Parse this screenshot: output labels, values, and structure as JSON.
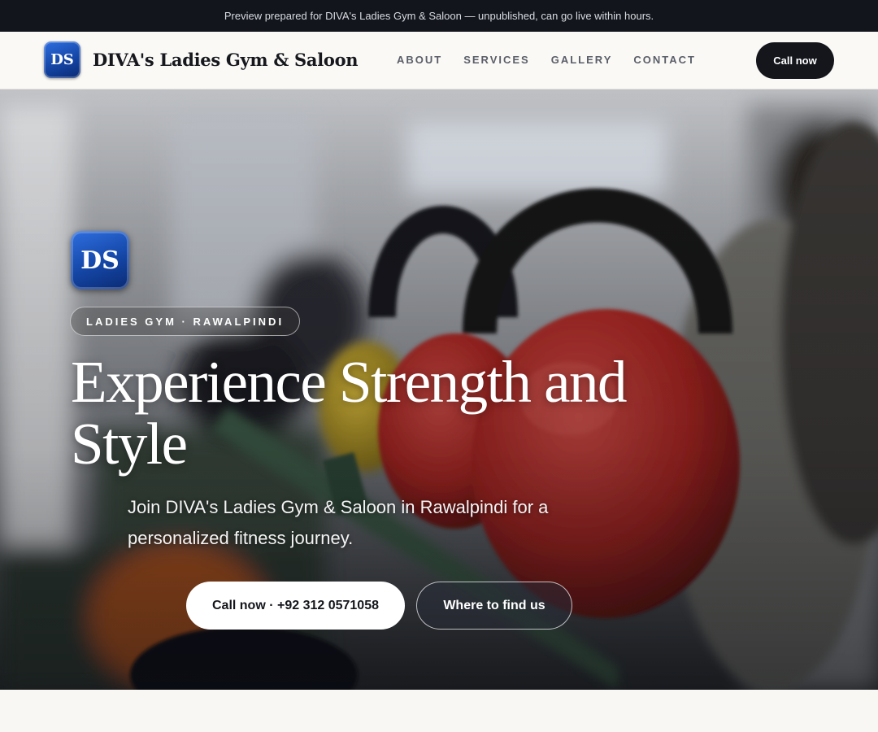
{
  "preview_banner": {
    "text": "Preview prepared for DIVA's Ladies Gym & Saloon — unpublished, can go live within hours."
  },
  "header": {
    "logo_text": "DS",
    "brand_name": "DIVA's Ladies Gym & Saloon",
    "nav": [
      {
        "label": "ABOUT"
      },
      {
        "label": "SERVICES"
      },
      {
        "label": "GALLERY"
      },
      {
        "label": "CONTACT"
      }
    ],
    "call_button": "Call now"
  },
  "hero": {
    "logo_text": "DS",
    "tag": "LADIES GYM · RAWALPINDI",
    "title": "Experience Strength and Style",
    "subtitle": "Join DIVA's Ladies Gym & Saloon in Rawalpindi for a personalized fitness journey.",
    "primary_button": "Call now · +92 312 0571058",
    "secondary_button": "Where to find us",
    "background_image": "kettlebells-gym-photo"
  },
  "colors": {
    "dark": "#12151c",
    "brand_blue": "#1446a6",
    "kettlebell_red": "#b02a2a",
    "background": "#f8f7f4"
  }
}
